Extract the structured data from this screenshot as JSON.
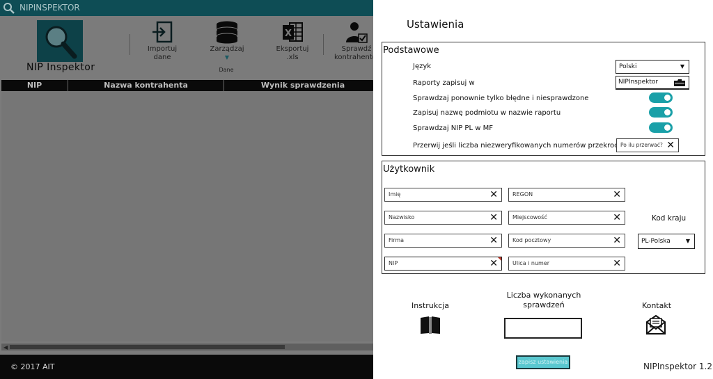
{
  "app": {
    "title": "NIPINSPEKTOR",
    "logo_text": "NIP Inspektor",
    "ribbon": {
      "import_label": "Importuj\ndane",
      "manage_label": "Zarządzaj",
      "group_label": "Dane",
      "export_label": "Eksportuj .xls",
      "check_label": "Sprawdź\nkontrahentów"
    },
    "grid": {
      "columns": [
        "NIP",
        "Nazwa kontrahenta",
        "Wynik sprawdzenia"
      ]
    },
    "footer": "© 2017 AIT"
  },
  "settings": {
    "title": "Ustawienia",
    "basic": {
      "title": "Podstawowe",
      "language_label": "Język",
      "language_value": "Polski",
      "reports_label": "Raporty zapisuj w",
      "reports_value": "NIPInspektor",
      "recheck_label": "Sprawdzaj ponownie tylko błędne i niesprawdzone",
      "save_name_label": "Zapisuj nazwę podmiotu w nazwie raportu",
      "check_mf_label": "Sprawdzaj NIP PL w MF",
      "abort_label": "Przerwij jeśli liczba niezweryfikowanych numerów przekroczy",
      "abort_placeholder": "Po ilu przerwać?"
    },
    "user": {
      "title": "Użytkownik",
      "fields_left": [
        "Imię",
        "Nazwisko",
        "Firma",
        "NIP"
      ],
      "fields_right": [
        "REGON",
        "Miejscowość",
        "Kod pocztowy",
        "Ulica i numer"
      ],
      "country_label": "Kod kraju",
      "country_value": "PL-Polska"
    },
    "bottom": {
      "instructions_label": "Instrukcja",
      "count_label": "Liczba wykonanych\nsprawdzeń",
      "contact_label": "Kontakt",
      "save_button": "zapisz ustawienia",
      "version": "NIPInspektor 1.2"
    }
  },
  "colors": {
    "accent": "#1aa0a8",
    "titlebar": "#0e4d55",
    "overlay_gray": "#7b7b7b"
  }
}
